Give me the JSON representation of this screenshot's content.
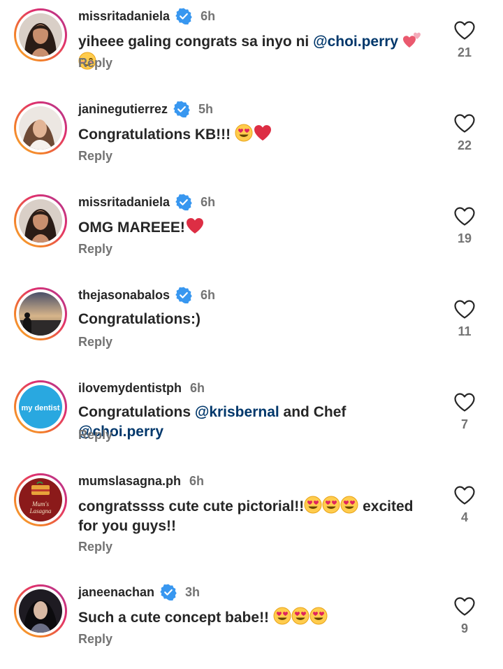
{
  "comments": [
    {
      "username": "missritadaniela",
      "verified": true,
      "time": "6h",
      "segments": [
        {
          "t": "yiheee galing congrats sa inyo ni "
        },
        {
          "t": "@choi.perry",
          "m": true
        },
        {
          "t": " "
        },
        {
          "e": "two-hearts"
        },
        {
          "e": "blush"
        }
      ],
      "reply": "Reply",
      "likes": "21",
      "avatar": "woman-portrait"
    },
    {
      "username": "janinegutierrez",
      "verified": true,
      "time": "5h",
      "segments": [
        {
          "t": "Congratulations KB!!! "
        },
        {
          "e": "heart-eyes"
        },
        {
          "e": "red-heart"
        }
      ],
      "reply": "Reply",
      "likes": "22",
      "avatar": "woman-light"
    },
    {
      "username": "missritadaniela",
      "verified": true,
      "time": "6h",
      "segments": [
        {
          "t": "OMG MAREEE!"
        },
        {
          "e": "red-heart"
        }
      ],
      "reply": "Reply",
      "likes": "19",
      "avatar": "woman-portrait"
    },
    {
      "username": "thejasonabalos",
      "verified": true,
      "time": "6h",
      "segments": [
        {
          "t": "Congratulations:)"
        }
      ],
      "reply": "Reply",
      "likes": "11",
      "avatar": "sunset"
    },
    {
      "username": "ilovemydentistph",
      "verified": false,
      "time": "6h",
      "segments": [
        {
          "t": "Congratulations "
        },
        {
          "t": "@krisbernal",
          "m": true
        },
        {
          "t": " and Chef "
        },
        {
          "t": "@choi.perry",
          "m": true
        }
      ],
      "reply": "Reply",
      "likes": "7",
      "avatar": "dentist-logo",
      "avatar_text": "my dentist"
    },
    {
      "username": "mumslasagna.ph",
      "verified": false,
      "time": "6h",
      "segments": [
        {
          "t": "congratssss cute cute pictorial!!"
        },
        {
          "e": "heart-eyes"
        },
        {
          "e": "heart-eyes"
        },
        {
          "e": "heart-eyes"
        },
        {
          "t": " excited for you guys!!"
        }
      ],
      "reply": "Reply",
      "likes": "4",
      "avatar": "lasagna-logo",
      "avatar_text": "Mum's Lasagna"
    },
    {
      "username": "janeenachan",
      "verified": true,
      "time": "3h",
      "segments": [
        {
          "t": "Such a cute concept babe!! "
        },
        {
          "e": "heart-eyes"
        },
        {
          "e": "heart-eyes"
        },
        {
          "e": "heart-eyes"
        }
      ],
      "reply": "Reply",
      "likes": "9",
      "avatar": "woman-dark"
    }
  ],
  "colors": {
    "text": "#262626",
    "muted": "#737373",
    "mention": "#00376b",
    "verified": "#3897f0"
  }
}
